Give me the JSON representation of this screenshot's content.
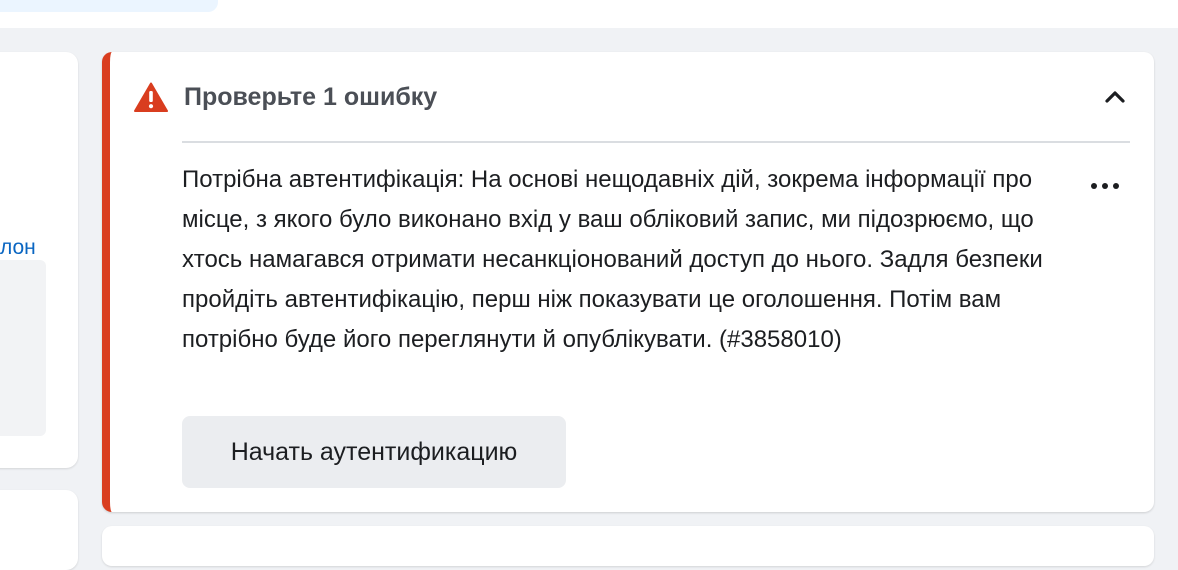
{
  "left_panel": {
    "link_fragment": "лон"
  },
  "error_panel": {
    "title": "Проверьте 1 ошибку",
    "message": "Потрібна автентифікація: На основі нещодавніх дій, зокрема інформації про місце, з якого було виконано вхід у ваш обліковий запис, ми підозрюємо, що хтось намагався отримати несанкціонований доступ до нього. Задля безпеки пройдіть автентифікацію, перш ніж показувати це оголошення. Потім вам потрібно буде його переглянути й опублікувати. (#3858010)",
    "action_label": "Начать аутентификацию",
    "icons": {
      "warning": "warning-triangle-icon",
      "collapse": "chevron-up-icon",
      "more": "more-horizontal-icon"
    }
  },
  "colors": {
    "error_accent": "#d93d1f",
    "link": "#0a66c2",
    "page_background": "#f0f2f5"
  }
}
